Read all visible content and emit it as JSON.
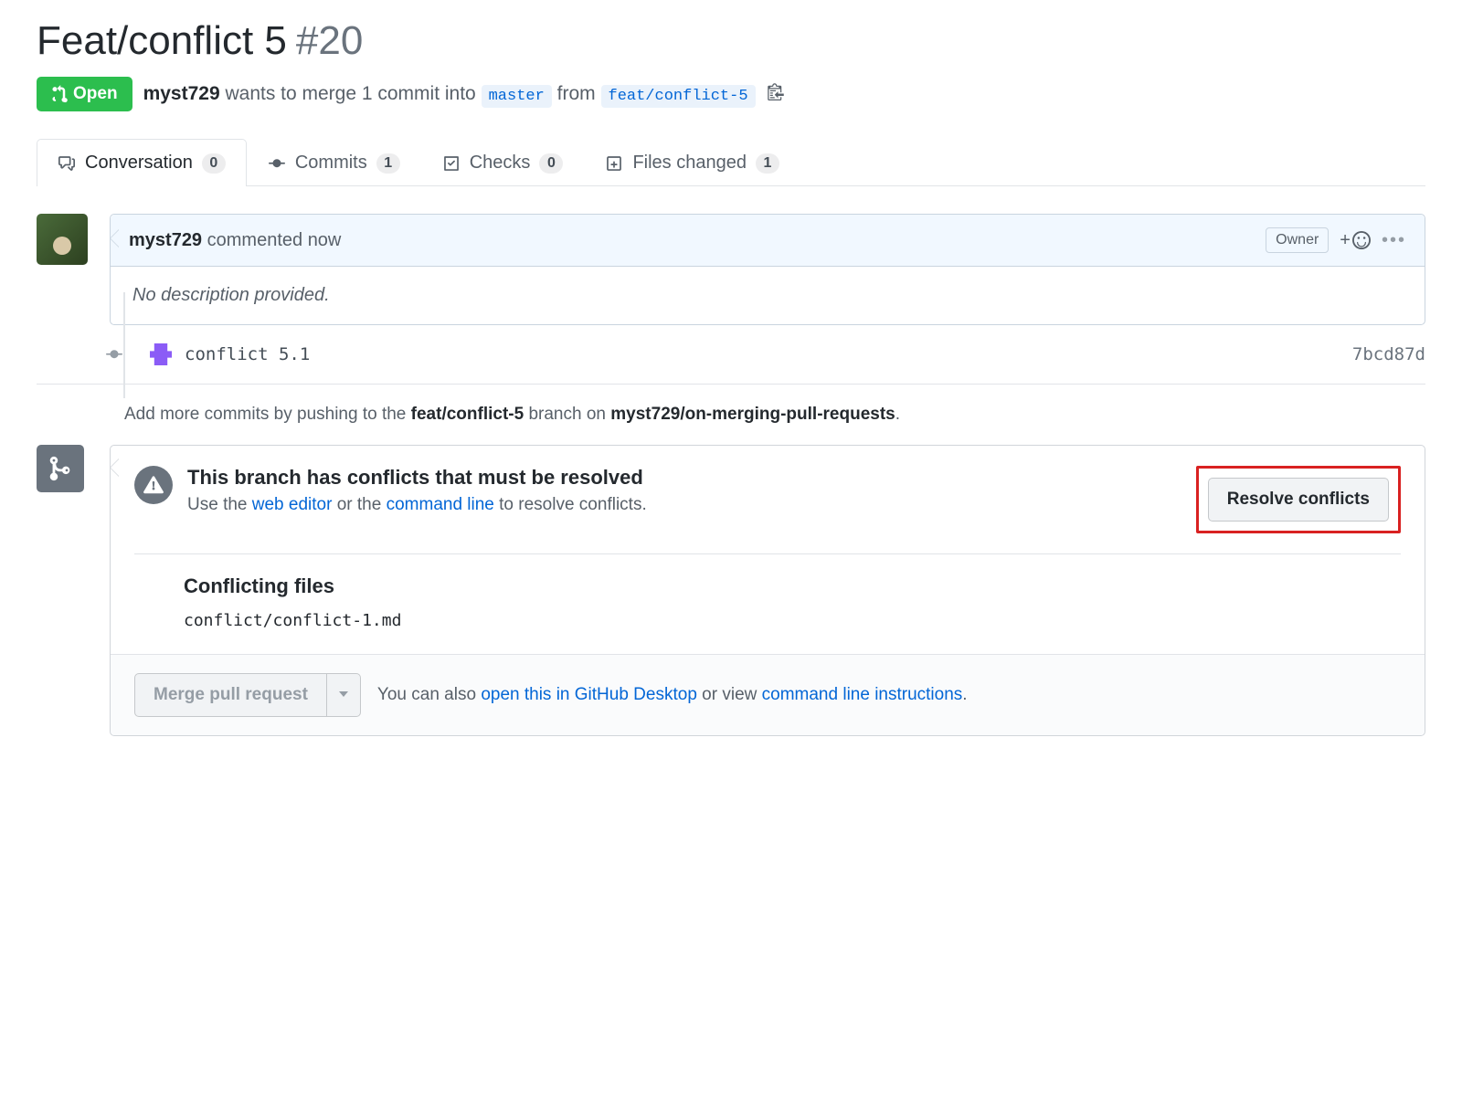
{
  "pr": {
    "title": "Feat/conflict 5",
    "number": "#20",
    "state": "Open",
    "author": "myst729",
    "merge_text_1": "wants to merge 1 commit into",
    "base_branch": "master",
    "merge_text_2": "from",
    "head_branch": "feat/conflict-5"
  },
  "tabs": {
    "conversation": {
      "label": "Conversation",
      "count": "0"
    },
    "commits": {
      "label": "Commits",
      "count": "1"
    },
    "checks": {
      "label": "Checks",
      "count": "0"
    },
    "files": {
      "label": "Files changed",
      "count": "1"
    }
  },
  "comment": {
    "author": "myst729",
    "action": "commented",
    "time": "now",
    "owner_badge": "Owner",
    "body": "No description provided."
  },
  "commit": {
    "message": "conflict 5.1",
    "sha": "7bcd87d"
  },
  "push_hint": {
    "prefix": "Add more commits by pushing to the ",
    "branch": "feat/conflict-5",
    "mid": " branch on ",
    "repo": "myst729/on-merging-pull-requests",
    "suffix": "."
  },
  "conflict": {
    "heading": "This branch has conflicts that must be resolved",
    "desc_prefix": "Use the ",
    "web_editor": "web editor",
    "desc_mid": " or the ",
    "command_line": "command line",
    "desc_suffix": " to resolve conflicts.",
    "resolve_button": "Resolve conflicts",
    "files_heading": "Conflicting files",
    "file": "conflict/conflict-1.md"
  },
  "merge_footer": {
    "merge_button": "Merge pull request",
    "text_prefix": "You can also ",
    "desktop_link": "open this in GitHub Desktop",
    "text_mid": " or view ",
    "cli_link": "command line instructions",
    "text_suffix": "."
  }
}
